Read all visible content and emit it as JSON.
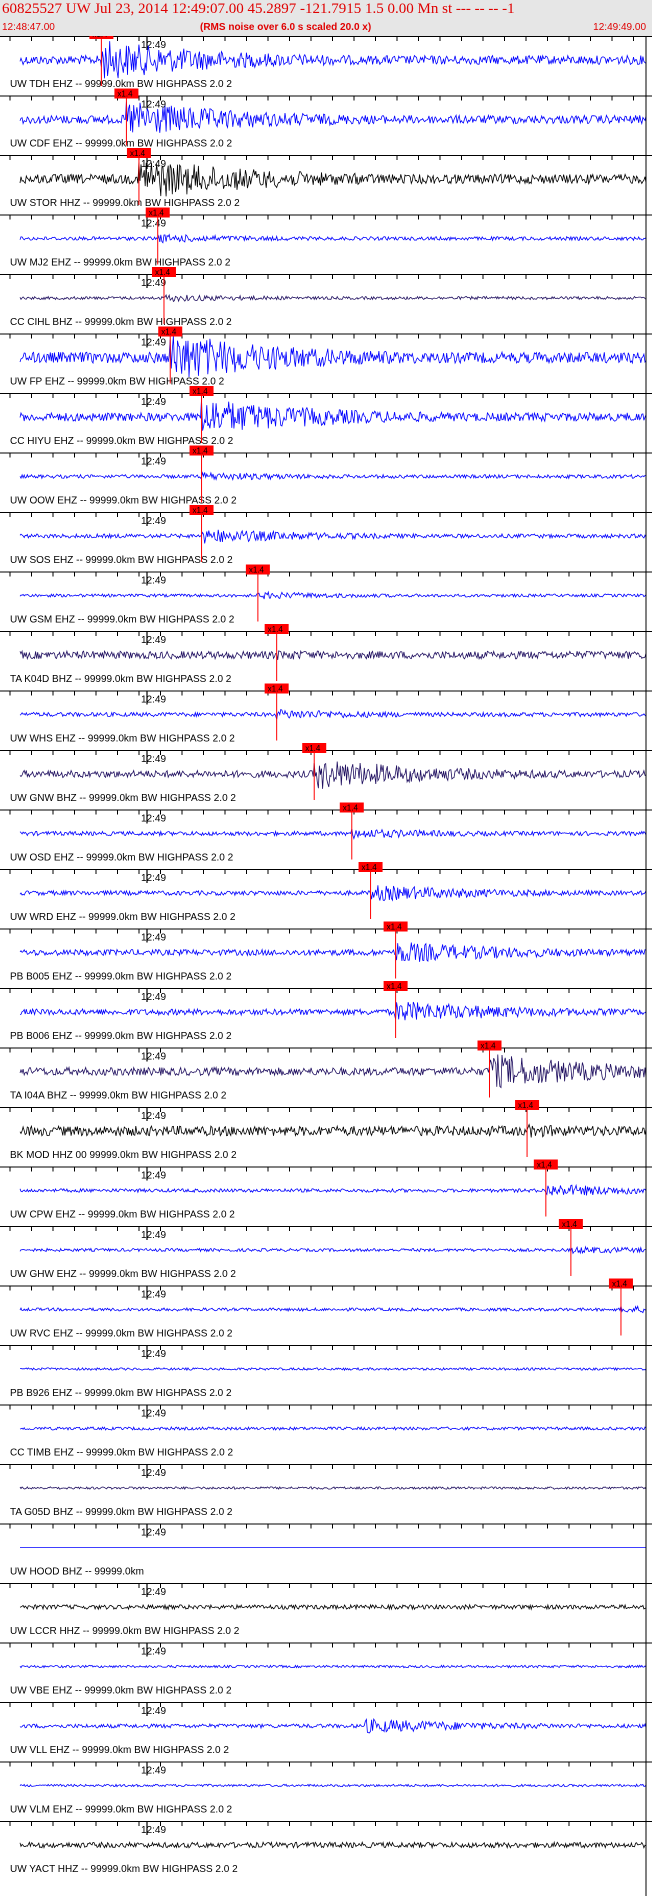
{
  "header": {
    "title": "60825527 UW Jul 23, 2014 12:49:07.00   45.2897 -121.7915  1.5 0.00 Mn st --- -- --  -1",
    "start_time": "12:48:47.00",
    "note": "(RMS noise over 6.0 s scaled 20.0 x)",
    "end_time": "12:49:49.00"
  },
  "panel": {
    "minute_label": "12:49",
    "pick_label": "x1.4"
  },
  "colors": {
    "blue": "#0000ff",
    "navy": "#201060",
    "black": "#000000",
    "pick": "#ff0000"
  },
  "traces": [
    {
      "label": "UW TDH EHZ -- 99999.0km BW  HIGHPASS  2.0  2",
      "color": "blue",
      "amp": 18,
      "arrival": 0.13,
      "env": "burst",
      "pick": true
    },
    {
      "label": "UW CDF EHZ -- 99999.0km BW  HIGHPASS  2.0  2",
      "color": "blue",
      "amp": 17,
      "arrival": 0.17,
      "env": "burst",
      "pick": true
    },
    {
      "label": "UW STOR HHZ -- 99999.0km BW  HIGHPASS  2.0  2",
      "color": "black",
      "amp": 19,
      "arrival": 0.19,
      "env": "burst",
      "pick": true
    },
    {
      "label": "UW MJ2 EHZ -- 99999.0km BW  HIGHPASS  2.0  2",
      "color": "blue",
      "amp": 6,
      "arrival": 0.22,
      "env": "low",
      "pick": true
    },
    {
      "label": "CC CIHL BHZ -- 99999.0km BW  HIGHPASS  2.0  2",
      "color": "navy",
      "amp": 5,
      "arrival": 0.23,
      "env": "low",
      "pick": true
    },
    {
      "label": "UW FP EHZ -- 99999.0km BW  HIGHPASS  2.0  2",
      "color": "blue",
      "amp": 22,
      "arrival": 0.24,
      "env": "burst",
      "pick": true
    },
    {
      "label": "CC HIYU EHZ -- 99999.0km BW  HIGHPASS  2.0  2",
      "color": "blue",
      "amp": 17,
      "arrival": 0.29,
      "env": "burst",
      "pick": true
    },
    {
      "label": "UW OOW EHZ -- 99999.0km BW  HIGHPASS  2.0  2",
      "color": "blue",
      "amp": 6,
      "arrival": 0.29,
      "env": "low",
      "pick": true
    },
    {
      "label": "UW SOS EHZ -- 99999.0km BW  HIGHPASS  2.0  2",
      "color": "blue",
      "amp": 8,
      "arrival": 0.29,
      "env": "mid",
      "pick": true
    },
    {
      "label": "UW GSM EHZ -- 99999.0km BW  HIGHPASS  2.0  2",
      "color": "blue",
      "amp": 5,
      "arrival": 0.38,
      "env": "low",
      "pick": true
    },
    {
      "label": "TA K04D BHZ -- 99999.0km BW  HIGHPASS  2.0  2",
      "color": "navy",
      "amp": 7,
      "arrival": 0.41,
      "env": "steady",
      "pick": true
    },
    {
      "label": "UW WHS EHZ -- 99999.0km BW  HIGHPASS  2.0  2",
      "color": "blue",
      "amp": 7,
      "arrival": 0.41,
      "env": "low",
      "pick": true
    },
    {
      "label": "UW GNW BHZ -- 99999.0km BW  HIGHPASS  2.0  2",
      "color": "navy",
      "amp": 14,
      "arrival": 0.47,
      "env": "burst",
      "pick": true
    },
    {
      "label": "UW OSD EHZ -- 99999.0km BW  HIGHPASS  2.0  2",
      "color": "blue",
      "amp": 7,
      "arrival": 0.53,
      "env": "low",
      "pick": true
    },
    {
      "label": "UW WRD EHZ -- 99999.0km BW  HIGHPASS  2.0  2",
      "color": "blue",
      "amp": 9,
      "arrival": 0.56,
      "env": "mid",
      "pick": true
    },
    {
      "label": "PB B005 EHZ -- 99999.0km BW  HIGHPASS  2.0  2",
      "color": "blue",
      "amp": 12,
      "arrival": 0.6,
      "env": "mid",
      "pick": true
    },
    {
      "label": "PB B006 EHZ -- 99999.0km BW  HIGHPASS  2.0  2",
      "color": "blue",
      "amp": 12,
      "arrival": 0.6,
      "env": "mid",
      "pick": true
    },
    {
      "label": "TA I04A BHZ -- 99999.0km BW  HIGHPASS  2.0  2",
      "color": "navy",
      "amp": 16,
      "arrival": 0.75,
      "env": "burst",
      "pick": true
    },
    {
      "label": "BK MOD HHZ 00 99999.0km BW  HIGHPASS  2.0  2",
      "color": "black",
      "amp": 9,
      "arrival": 0.81,
      "env": "steady",
      "pick": true
    },
    {
      "label": "UW CPW EHZ -- 99999.0km BW  HIGHPASS  2.0  2",
      "color": "blue",
      "amp": 7,
      "arrival": 0.84,
      "env": "mid",
      "pick": true
    },
    {
      "label": "UW GHW EHZ -- 99999.0km BW  HIGHPASS  2.0  2",
      "color": "blue",
      "amp": 5,
      "arrival": 0.88,
      "env": "low",
      "pick": true
    },
    {
      "label": "UW RVC EHZ -- 99999.0km BW  HIGHPASS  2.0  2",
      "color": "blue",
      "amp": 5,
      "arrival": 0.96,
      "env": "low",
      "pick": true
    },
    {
      "label": "PB B926 EHZ -- 99999.0km BW  HIGHPASS  2.0  2",
      "color": "blue",
      "amp": 4,
      "arrival": 0,
      "env": "low",
      "pick": false
    },
    {
      "label": "CC TIMB EHZ -- 99999.0km BW  HIGHPASS  2.0  2",
      "color": "blue",
      "amp": 5,
      "arrival": 0,
      "env": "low",
      "pick": false
    },
    {
      "label": "TA G05D BHZ -- 99999.0km BW  HIGHPASS  2.0  2",
      "color": "navy",
      "amp": 4,
      "arrival": 0,
      "env": "low",
      "pick": false
    },
    {
      "label": "UW HOOD BHZ -- 99999.0km",
      "color": "blue",
      "amp": 0,
      "arrival": 0,
      "env": "flat",
      "pick": false
    },
    {
      "label": "UW LCCR HHZ -- 99999.0km BW  HIGHPASS  2.0  2",
      "color": "black",
      "amp": 4,
      "arrival": 0,
      "env": "steady",
      "pick": false
    },
    {
      "label": "UW VBE EHZ -- 99999.0km BW  HIGHPASS  2.0  2",
      "color": "blue",
      "amp": 4,
      "arrival": 0,
      "env": "low",
      "pick": false
    },
    {
      "label": "UW VLL EHZ -- 99999.0km BW  HIGHPASS  2.0  2",
      "color": "blue",
      "amp": 8,
      "arrival": 0.55,
      "env": "mid",
      "pick": false
    },
    {
      "label": "UW VLM EHZ -- 99999.0km BW  HIGHPASS  2.0  2",
      "color": "blue",
      "amp": 4,
      "arrival": 0,
      "env": "low",
      "pick": false
    },
    {
      "label": "UW YACT HHZ -- 99999.0km BW  HIGHPASS  2.0  2",
      "color": "black",
      "amp": 5,
      "arrival": 0,
      "env": "steady",
      "pick": false
    }
  ]
}
